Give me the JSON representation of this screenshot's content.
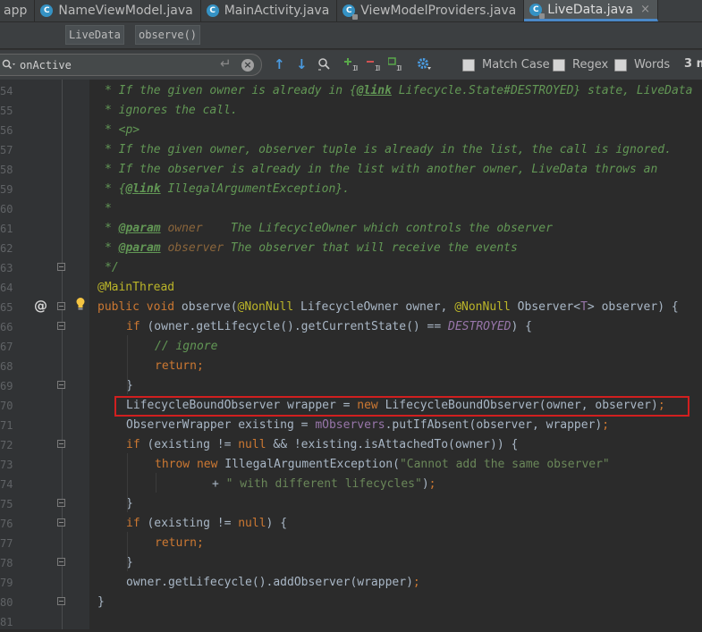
{
  "tabs": [
    {
      "label": "app",
      "active": false,
      "icon": "folder-icon",
      "closable": false
    },
    {
      "label": "NameViewModel.java",
      "active": false,
      "icon": "class-icon",
      "closable": false
    },
    {
      "label": "MainActivity.java",
      "active": false,
      "icon": "class-icon",
      "closable": false
    },
    {
      "label": "ViewModelProviders.java",
      "active": false,
      "icon": "class-locked-icon",
      "closable": false
    },
    {
      "label": "LiveData.java",
      "active": true,
      "icon": "class-locked-icon",
      "closable": true
    }
  ],
  "tab_close_glyph": "×",
  "breadcrumb": [
    "LiveData",
    "observe()"
  ],
  "search": {
    "value": "onActive",
    "placeholder": "",
    "enter_glyph": "↵",
    "clear_glyph": "×",
    "options": [
      {
        "label": "Match Case",
        "checked": false
      },
      {
        "label": "Regex",
        "checked": false
      },
      {
        "label": "Words",
        "checked": false
      }
    ],
    "match_count": "3 m"
  },
  "gutter": {
    "line_numbers": [
      "54",
      "55",
      "56",
      "57",
      "58",
      "59",
      "60",
      "61",
      "62",
      "63",
      "64",
      "65",
      "66",
      "67",
      "68",
      "69",
      "70",
      "71",
      "72",
      "73",
      "74",
      "75",
      "76",
      "77",
      "78",
      "79",
      "80",
      "81"
    ]
  },
  "code_lines": [
    [
      {
        "t": "* If the given owner is already in {",
        "s": "c"
      },
      {
        "t": "@link",
        "s": "ctag"
      },
      {
        "t": " Lifecycle.State#DESTROYED} state, LiveData",
        "s": "c"
      }
    ],
    [
      {
        "t": "* ignores the call.",
        "s": "c"
      }
    ],
    [
      {
        "t": "* <p>",
        "s": "c"
      }
    ],
    [
      {
        "t": "* If the given owner, observer tuple is already in the list, the call is ignored.",
        "s": "c"
      }
    ],
    [
      {
        "t": "* If the observer is already in the list with another owner, LiveData throws an",
        "s": "c"
      }
    ],
    [
      {
        "t": "* {",
        "s": "c"
      },
      {
        "t": "@link",
        "s": "ctag"
      },
      {
        "t": " IllegalArgumentException}.",
        "s": "c"
      }
    ],
    [
      {
        "t": "*",
        "s": "c"
      }
    ],
    [
      {
        "t": "* ",
        "s": "c"
      },
      {
        "t": "@param",
        "s": "ctag"
      },
      {
        "t": " owner",
        "s": "cparam"
      },
      {
        "t": "    The LifecycleOwner which controls the observer",
        "s": "c"
      }
    ],
    [
      {
        "t": "* ",
        "s": "c"
      },
      {
        "t": "@param",
        "s": "ctag"
      },
      {
        "t": " observer",
        "s": "cparam"
      },
      {
        "t": " The observer that will receive the events",
        "s": "c"
      }
    ],
    [
      {
        "t": "*/",
        "s": "c"
      }
    ],
    [
      {
        "t": "@MainThread",
        "s": "ann"
      }
    ],
    [
      {
        "t": "public void ",
        "s": "kw"
      },
      {
        "t": "observe",
        "s": "p"
      },
      {
        "t": "(",
        "s": "p"
      },
      {
        "t": "@NonNull",
        "s": "ann"
      },
      {
        "t": " LifecycleOwner owner, ",
        "s": "p"
      },
      {
        "t": "@NonNull",
        "s": "ann"
      },
      {
        "t": " Observer<",
        "s": "p"
      },
      {
        "t": "T",
        "s": "fld"
      },
      {
        "t": "> observer) {",
        "s": "p"
      }
    ],
    [
      {
        "t": "if ",
        "s": "kw"
      },
      {
        "t": "(owner.getLifecycle().getCurrentState() == ",
        "s": "p"
      },
      {
        "t": "DESTROYED",
        "s": "fldi"
      },
      {
        "t": ") {",
        "s": "p"
      }
    ],
    [
      {
        "t": "// ignore",
        "s": "cm"
      }
    ],
    [
      {
        "t": "return;",
        "s": "kw"
      }
    ],
    [
      {
        "t": "}",
        "s": "p"
      }
    ],
    [
      {
        "t": "LifecycleBoundObserver wrapper = ",
        "s": "p"
      },
      {
        "t": "new ",
        "s": "kw"
      },
      {
        "t": "LifecycleBoundObserver(owner, observer)",
        "s": "p"
      },
      {
        "t": ";",
        "s": "kw"
      }
    ],
    [
      {
        "t": "ObserverWrapper existing = ",
        "s": "p"
      },
      {
        "t": "mObservers",
        "s": "fld"
      },
      {
        "t": ".putIfAbsent(observer, wrapper)",
        "s": "p"
      },
      {
        "t": ";",
        "s": "kw"
      }
    ],
    [
      {
        "t": "if ",
        "s": "kw"
      },
      {
        "t": "(existing != ",
        "s": "p"
      },
      {
        "t": "null ",
        "s": "kw"
      },
      {
        "t": "&& !existing.isAttachedTo(owner)) {",
        "s": "p"
      }
    ],
    [
      {
        "t": "throw new ",
        "s": "kw"
      },
      {
        "t": "IllegalArgumentException(",
        "s": "p"
      },
      {
        "t": "\"Cannot add the same observer\"",
        "s": "str"
      }
    ],
    [
      {
        "t": "+ ",
        "s": "p"
      },
      {
        "t": "\" with different lifecycles\"",
        "s": "str"
      },
      {
        "t": ")",
        "s": "p"
      },
      {
        "t": ";",
        "s": "kw"
      }
    ],
    [
      {
        "t": "}",
        "s": "p"
      }
    ],
    [
      {
        "t": "if ",
        "s": "kw"
      },
      {
        "t": "(existing != ",
        "s": "p"
      },
      {
        "t": "null",
        "s": "kw"
      },
      {
        "t": ") {",
        "s": "p"
      }
    ],
    [
      {
        "t": "return;",
        "s": "kw"
      }
    ],
    [
      {
        "t": "}",
        "s": "p"
      }
    ],
    [
      {
        "t": "owner.getLifecycle().addObserver(wrapper)",
        "s": "p"
      },
      {
        "t": ";",
        "s": "kw"
      }
    ],
    [
      {
        "t": "}",
        "s": "p"
      }
    ],
    []
  ],
  "gutter_marks": {
    "override_glyph": "@"
  },
  "colors": {
    "background": "#2b2b2b",
    "gutter": "#313335",
    "keyword": "#cc7832",
    "annotation": "#bbb529",
    "comment": "#629755",
    "string": "#6a8759",
    "field": "#9876aa",
    "highlight_box": "#d11f1f"
  }
}
